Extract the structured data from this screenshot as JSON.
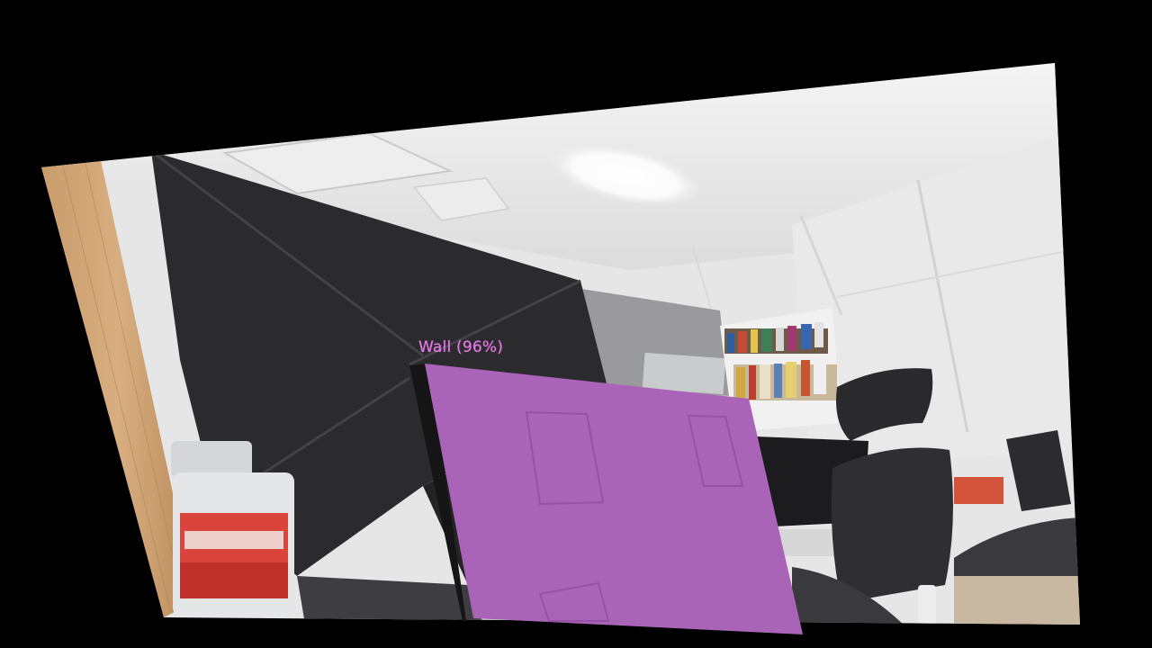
{
  "detection": {
    "label": "Wall",
    "confidence_percent": 96,
    "caption": "Wall (96%)",
    "overlay_color": "#a964b8"
  },
  "scene": {
    "objects": [
      "wooden-door-frame",
      "black-room-divider",
      "ceiling-light",
      "bookshelf",
      "office-chair",
      "monitor",
      "snack-jar",
      "pc-tower"
    ]
  }
}
